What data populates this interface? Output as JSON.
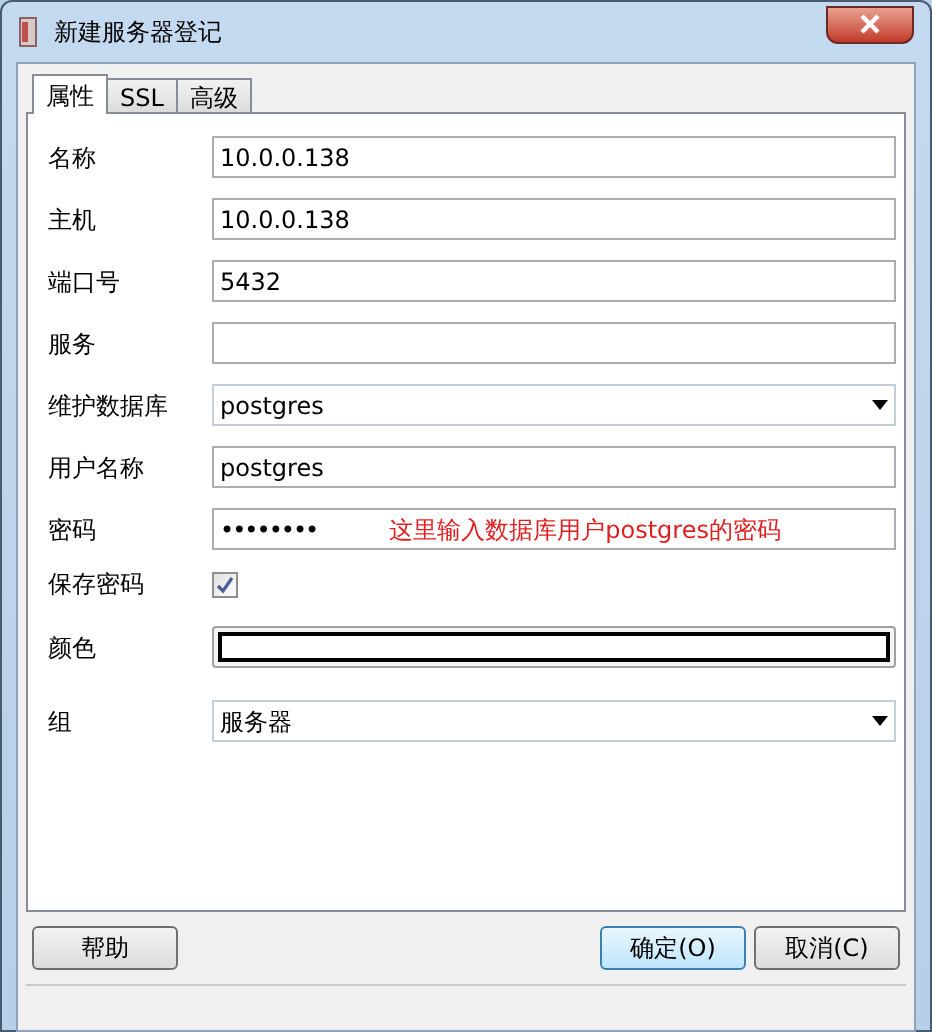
{
  "window": {
    "title": "新建服务器登记"
  },
  "tabs": [
    {
      "label": "属性",
      "selected": true
    },
    {
      "label": "SSL",
      "selected": false
    },
    {
      "label": "高级",
      "selected": false
    }
  ],
  "fields": [
    {
      "kind": "text",
      "label": "名称",
      "value": "10.0.0.138"
    },
    {
      "kind": "text",
      "label": "主机",
      "value": "10.0.0.138"
    },
    {
      "kind": "text",
      "label": "端口号",
      "value": "5432"
    },
    {
      "kind": "text",
      "label": "服务"
    },
    {
      "kind": "dropdown",
      "label": "维护数据库",
      "value": "postgres"
    },
    {
      "kind": "text",
      "label": "用户名称",
      "value": "postgres"
    },
    {
      "kind": "password",
      "label": "密码",
      "value": "••••••••",
      "annotation": "这里输入数据库用户postgres的密码"
    },
    {
      "kind": "checkbox",
      "label": "保存密码",
      "checked": true
    },
    {
      "kind": "color",
      "label": "颜色"
    },
    {
      "kind": "dropdown",
      "label": "组",
      "value": "服务器"
    }
  ],
  "buttons": {
    "help": "帮助",
    "ok": "确定(O)",
    "cancel": "取消(C)"
  }
}
